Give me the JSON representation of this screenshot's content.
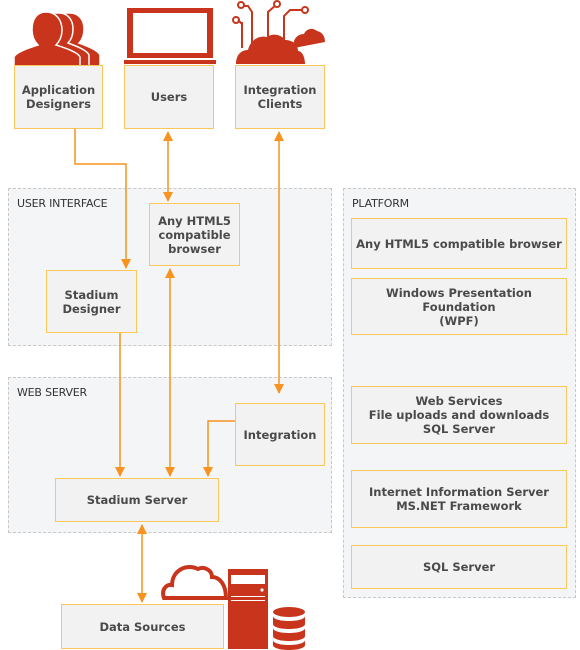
{
  "colors": {
    "accent": "#c8351c",
    "connector": "#f7931e",
    "box_border": "#fbc75b",
    "box_fill": "#f2f2f2",
    "panel_fill": "#f4f5f7"
  },
  "actors": [
    {
      "label": "Application\nDesigners",
      "icon": "people-icon"
    },
    {
      "label": "Users",
      "icon": "laptop-icon"
    },
    {
      "label": "Integration\nClients",
      "icon": "cloud-circuit-icon"
    }
  ],
  "user_interface": {
    "title": "USER INTERFACE",
    "browser": "Any HTML5\ncompatible\nbrowser",
    "designer": "Stadium\nDesigner"
  },
  "web_server": {
    "title": "WEB SERVER",
    "integration": "Integration",
    "server": "Stadium Server"
  },
  "data_sources": {
    "label": "Data Sources",
    "icons": [
      "cloud-icon",
      "server-tower-icon",
      "database-icon"
    ]
  },
  "platform": {
    "title": "PLATFORM",
    "items": [
      "Any HTML5 compatible browser",
      "Windows Presentation Foundation\n(WPF)",
      "Web Services\nFile uploads and downloads\nSQL Server",
      "Internet Information Server\nMS.NET Framework",
      "SQL Server"
    ]
  }
}
